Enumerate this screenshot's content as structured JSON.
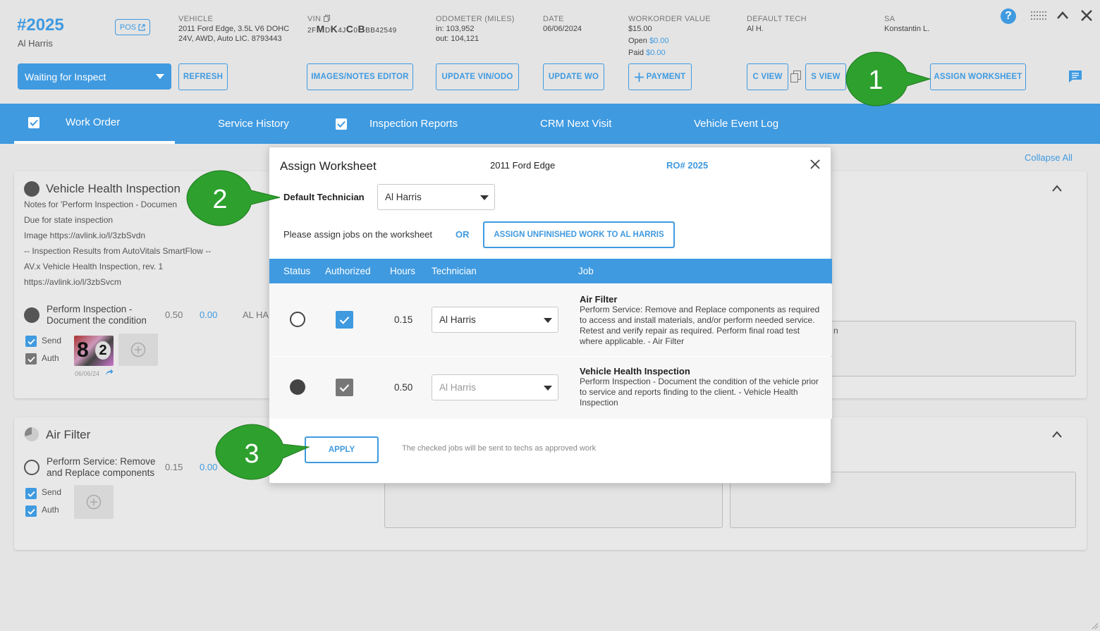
{
  "header": {
    "wo_number": "#2025",
    "customer": "Al Harris",
    "pos_label": "POS",
    "vehicle": {
      "label": "VEHICLE",
      "line1": "2011 Ford Edge, 3.5L V6 DOHC",
      "line2": "24V, AWD, Auto LIC. 8793443"
    },
    "vin": {
      "label": "VIN",
      "p1": "2F",
      "p2": "M",
      "p3": "D",
      "p4": "K",
      "p5": "4J",
      "p6": "C",
      "p7": "0",
      "p8": "B",
      "p9": "BB42549"
    },
    "odometer": {
      "label": "ODOMETER (MILES)",
      "in": "in: 103,952",
      "out": "out: 104,121"
    },
    "date": {
      "label": "DATE",
      "value": "06/06/2024"
    },
    "wo_value": {
      "label": "WORKORDER VALUE",
      "value": "$15.00",
      "open_label": "Open",
      "open_value": "$0.00",
      "paid_label": "Paid",
      "paid_value": "$0.00"
    },
    "default_tech": {
      "label": "DEFAULT TECH",
      "value": "Al H."
    },
    "sa": {
      "label": "SA",
      "value": "Konstantin L."
    },
    "help": "?"
  },
  "toolbar": {
    "status": "Waiting for Inspect",
    "refresh": "REFRESH",
    "images_notes": "IMAGES/NOTES EDITOR",
    "update_vin": "UPDATE VIN/ODO",
    "update_wo": "UPDATE WO",
    "payment": "PAYMENT",
    "c_view": "C VIEW",
    "s_view": "S VIEW",
    "assign_worksheet": "ASSIGN WORKSHEET"
  },
  "tabs": [
    {
      "label": "Work Order",
      "checked": true
    },
    {
      "label": "Service History"
    },
    {
      "label": "Inspection Reports",
      "checked": true
    },
    {
      "label": "CRM Next Visit"
    },
    {
      "label": "Vehicle Event Log"
    }
  ],
  "collapse_all": "Collapse All",
  "cards": {
    "vhi": {
      "title": "Vehicle Health Inspection",
      "notes": [
        "Notes for 'Perform Inspection - Documen",
        "Due for state inspection",
        "Image https://avlink.io/l/3zbSvdn",
        "-- Inspection Results from AutoVitals SmartFlow --",
        "AV.x Vehicle Health Inspection, rev. 1",
        "https://avlink.io/l/3zbSvcm"
      ],
      "job_line1": "Perform Inspection -",
      "job_line2": "Document the condition",
      "hours": "0.50",
      "price": "0.00",
      "tech": "AL HA",
      "send": "Send",
      "auth": "Auth",
      "thumb_date": "06/06/24",
      "notes_text": "n"
    },
    "air": {
      "title": "Air Filter",
      "job_line1": "Perform Service: Remove",
      "job_line2": "and Replace components",
      "hours": "0.15",
      "price": "0.00",
      "send": "Send",
      "auth": "Auth"
    }
  },
  "modal": {
    "title": "Assign Worksheet",
    "vehicle": "2011 Ford Edge",
    "ro": "RO# 2025",
    "default_tech_label": "Default Technician",
    "default_tech_value": "Al Harris",
    "please_text": "Please assign jobs on the worksheet",
    "or_text": "OR",
    "assign_unfinished": "ASSIGN UNFINISHED WORK TO AL HARRIS",
    "columns": [
      "Status",
      "Authorized",
      "Hours",
      "Technician",
      "Job"
    ],
    "rows": [
      {
        "hours": "0.15",
        "technician": "Al Harris",
        "job_title": "Air Filter",
        "job_desc": "Perform Service: Remove and Replace components as required to access and install materials, and/or perform needed service. Retest and verify repair as required. Perform final road test where applicable. - Air Filter"
      },
      {
        "hours": "0.50",
        "technician": "Al Harris",
        "job_title": "Vehicle Health Inspection",
        "job_desc": "Perform Inspection - Document the condition of the vehicle prior to service and reports finding to the client. - Vehicle Health Inspection"
      }
    ],
    "apply": "APPLY",
    "note": "The checked jobs will be sent to techs as approved work"
  },
  "callouts": [
    "1",
    "2",
    "3"
  ],
  "colors": {
    "accent": "#3f9ae0",
    "callout": "#2ea02e"
  }
}
